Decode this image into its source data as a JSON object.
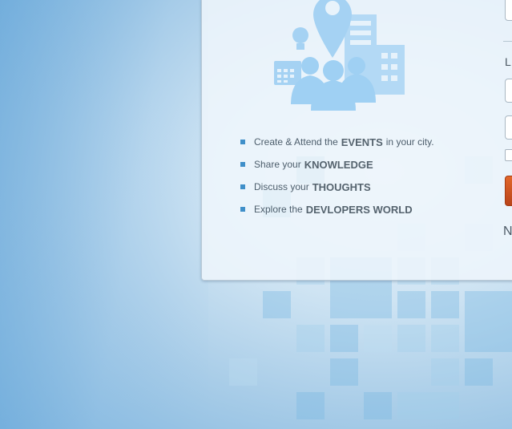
{
  "features": [
    {
      "prefix": "Create & Attend the",
      "highlight": "EVENTS",
      "suffix": "in your city."
    },
    {
      "prefix": "Share your",
      "highlight": "KNOWLEDGE",
      "suffix": ""
    },
    {
      "prefix": "Discuss your",
      "highlight": "THOUGHTS",
      "suffix": ""
    },
    {
      "prefix": "Explore the",
      "highlight": "DEVLOPERS WORLD",
      "suffix": ""
    }
  ],
  "login": {
    "heading_partial": "L",
    "footer_partial": "N"
  },
  "colors": {
    "accent_button": "#d0561f",
    "bullet": "#3f8fc9",
    "illustration": "#8ec6ef"
  },
  "icons": [
    "map-pin-icon",
    "lightbulb-icon",
    "calendar-icon",
    "people-icon",
    "buildings-icon"
  ]
}
